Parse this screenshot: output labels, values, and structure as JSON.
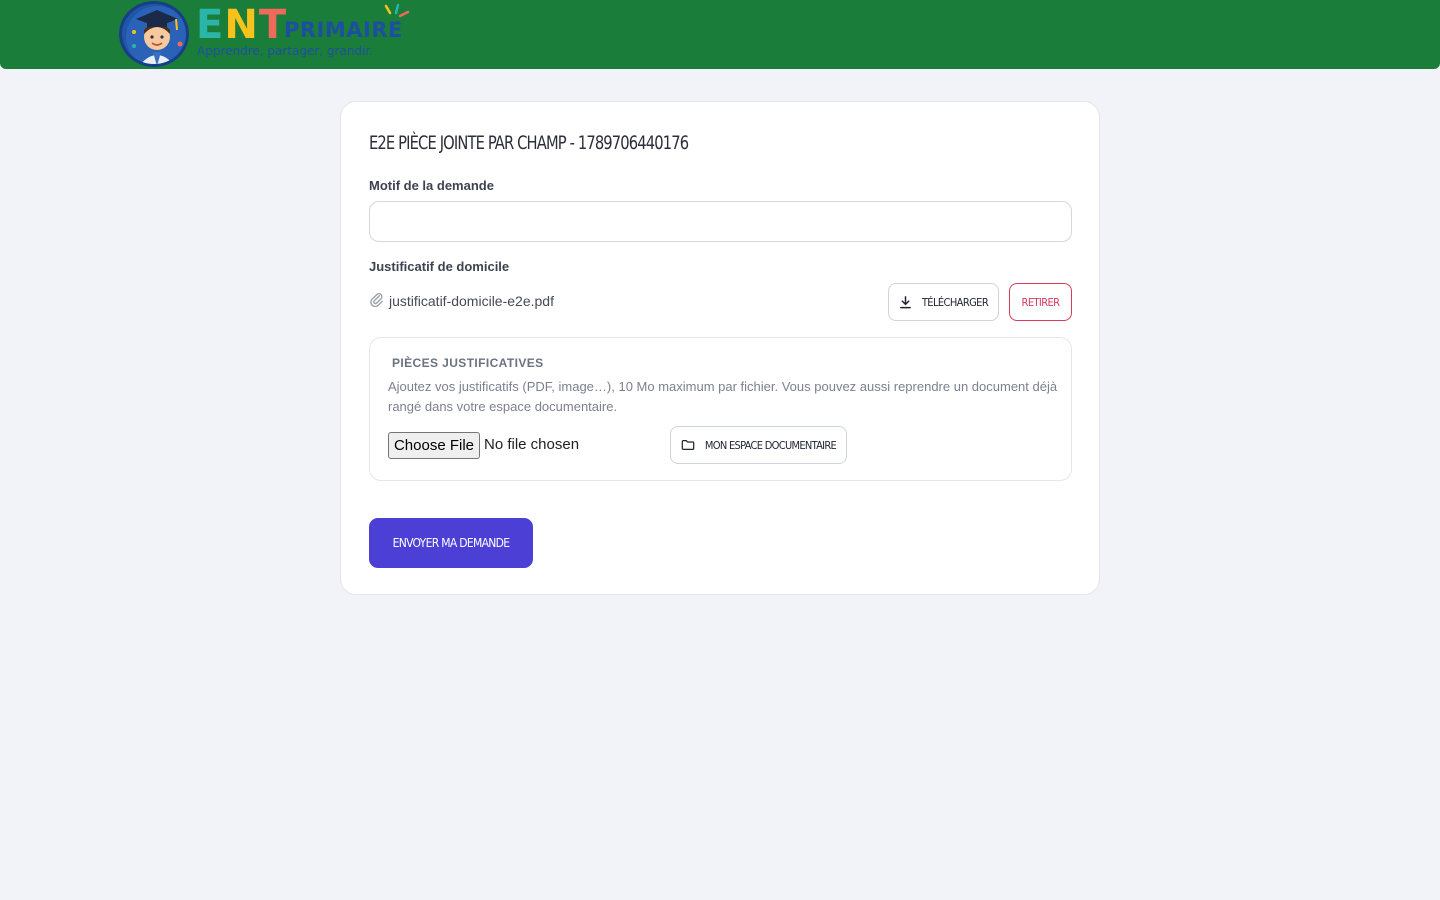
{
  "brand": {
    "logo_letters": [
      "E",
      "N",
      "T"
    ],
    "logo_sub": "PRIMAIRE",
    "tagline": "Apprendre, partager, grandir."
  },
  "form": {
    "title": "E2E pièce jointe par champ - 1789706440176",
    "motif_label": "Motif de la demande",
    "motif_value": "",
    "justificatif_label": "Justificatif de domicile",
    "attached_file": "justificatif-domicile-e2e.pdf",
    "download_label": "Télécharger",
    "remove_label": "Retirer",
    "pieces": {
      "title": "PIÈCES JUSTIFICATIVES",
      "description": "Ajoutez vos justificatifs (PDF, image…), 10 Mo maximum par fichier. Vous pouvez aussi reprendre un document déjà rangé dans votre espace documentaire.",
      "choose_file_label": "Choose File",
      "no_file_label": "No file chosen",
      "space_button_label": "Mon espace documentaire"
    },
    "submit_label": "Envoyer ma demande"
  },
  "colors": {
    "header": "#1b7d3a",
    "primary": "#4c3fd6",
    "danger": "#d63b5a",
    "background": "#f1f3f8"
  },
  "icons": {
    "download": "download-icon",
    "folder": "folder-icon",
    "attachment": "paperclip-icon"
  }
}
